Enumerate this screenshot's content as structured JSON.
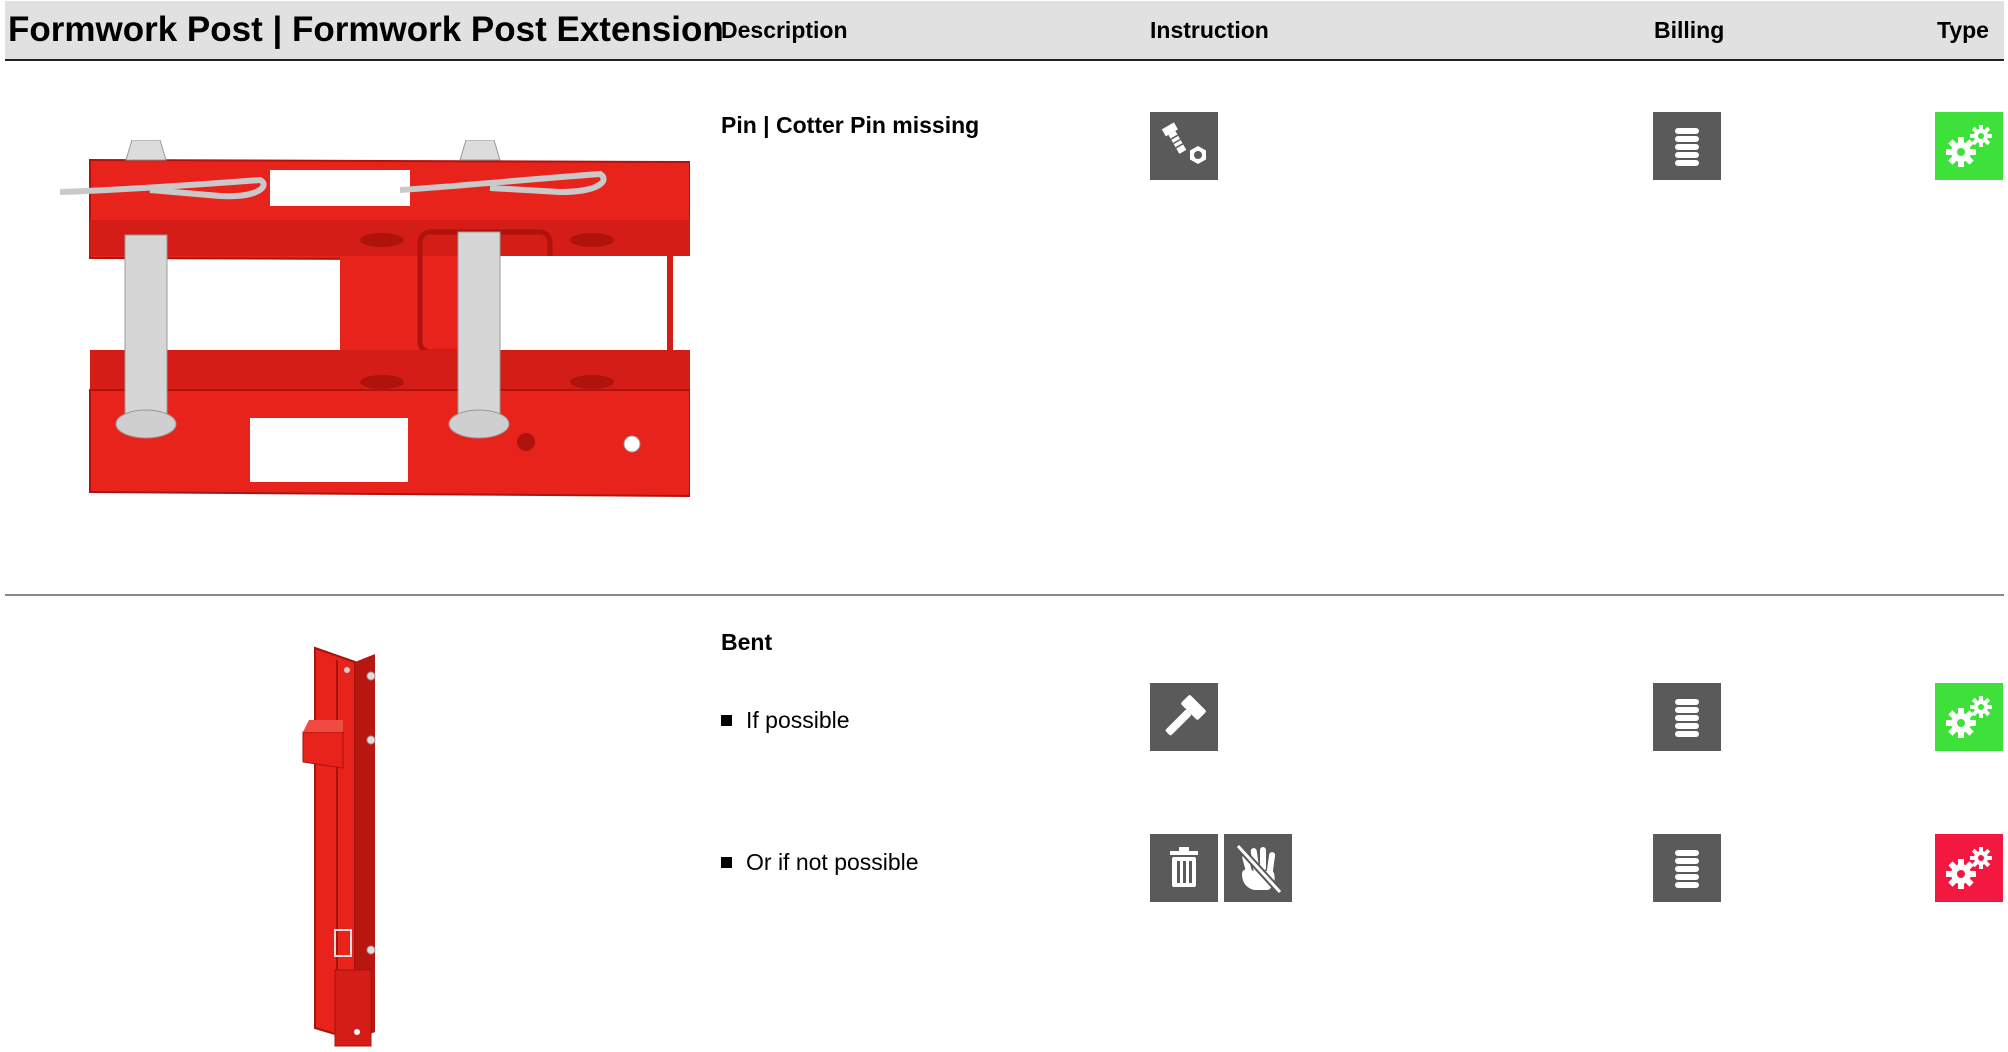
{
  "header": {
    "title": "Formwork Post | Formwork Post Extension",
    "col_description": "Description",
    "col_instruction": "Instruction",
    "col_billing": "Billing",
    "col_type": "Type"
  },
  "rows": [
    {
      "title": "Pin | Cotter Pin missing",
      "image": "formwork-post-pins-illustration",
      "instruction_icons": [
        "bolt-nut-icon"
      ],
      "billing_icon": "coin-stack-icon",
      "type_icon": "gears-icon",
      "type_color": "#3ee13a"
    },
    {
      "title": "Bent",
      "image": "formwork-post-extension-illustration",
      "items": [
        {
          "label": "If possible",
          "instruction_icons": [
            "hammer-icon"
          ],
          "billing_icon": "coin-stack-icon",
          "type_icon": "gears-icon",
          "type_color": "#3ee13a"
        },
        {
          "label": "Or if not possible",
          "instruction_icons": [
            "trash-icon",
            "no-touch-icon"
          ],
          "billing_icon": "coin-stack-icon",
          "type_icon": "gears-icon",
          "type_color": "#f21840"
        }
      ]
    }
  ],
  "colors": {
    "header_bg": "#e1e1e1",
    "icon_bg": "#5a5a5a",
    "part_red": "#e8231c",
    "ok_green": "#3ee13a",
    "scrap_red": "#f21840"
  }
}
